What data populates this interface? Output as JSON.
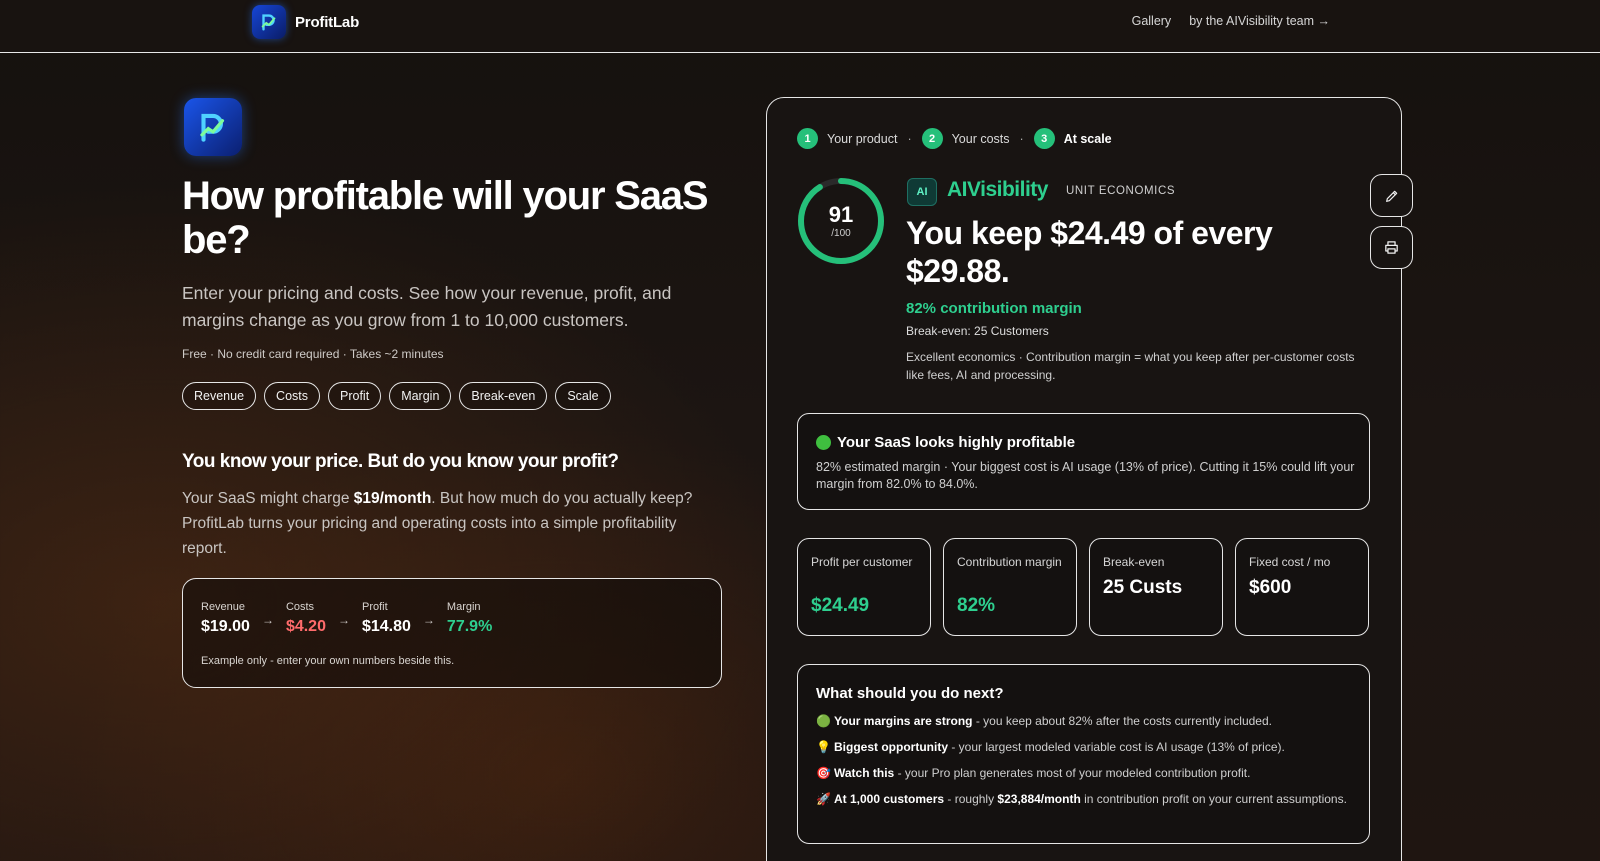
{
  "header": {
    "brand": "ProfitLab",
    "nav": [
      "Gallery",
      "by the AIVisibility team →"
    ]
  },
  "hero": {
    "title": "How profitable will your SaaS be?",
    "subtitle": "Enter your pricing and costs. See how your revenue, profit, and margins change as you grow from 1 to 10,000 customers.",
    "meta": "Free · No credit card required · Takes ~2 minutes",
    "chips": [
      "Revenue",
      "Costs",
      "Profit",
      "Margin",
      "Break-even",
      "Scale"
    ]
  },
  "question": {
    "title": "You know your price. But do you know your profit?",
    "body_pre": "Your SaaS might charge ",
    "body_bold": "$19/month",
    "body_post": ". But how much do you actually keep? ProfitLab turns your pricing and operating costs into a simple profitability report."
  },
  "example": {
    "items": [
      {
        "label": "Revenue",
        "value": "$19.00"
      },
      {
        "label": "Costs",
        "value": "$4.20"
      },
      {
        "label": "Profit",
        "value": "$14.80"
      },
      {
        "label": "Margin",
        "value": "77.9%"
      }
    ],
    "arrow": "→",
    "note": "Example only - enter your own numbers beside this."
  },
  "steps": [
    {
      "num": "1",
      "label": "Your product"
    },
    {
      "num": "2",
      "label": "Your costs"
    },
    {
      "num": "3",
      "label": "At scale"
    }
  ],
  "step_sep": "·",
  "score": {
    "value": "91",
    "denominator": "/100",
    "fraction": 0.91
  },
  "product": {
    "badge": "AI",
    "name": "AIVisibility",
    "tag": "UNIT ECONOMICS",
    "headline": "You keep $24.49 of every $29.88.",
    "contribution": "82% contribution margin",
    "breakeven": "Break-even: 25 Customers",
    "explain": "Excellent economics · Contribution margin = what you keep after per-customer costs like fees, AI and processing."
  },
  "actions": {
    "edit": "pencil-icon",
    "print": "printer-icon"
  },
  "summary": {
    "title": "Your SaaS looks highly profitable",
    "body": "82% estimated margin · Your biggest cost is AI usage (13% of price). Cutting it 15% could lift your margin from 82.0% to 84.0%."
  },
  "metrics": [
    {
      "label": "Profit per customer",
      "value": "$24.49"
    },
    {
      "label": "Contribution margin",
      "value": "82%"
    },
    {
      "label": "Break-even",
      "value": "25 Custs"
    },
    {
      "label": "Fixed cost / mo",
      "value": "$600"
    }
  ],
  "next": {
    "title": "What should you do next?",
    "items": [
      {
        "icon": "🟢",
        "bold": "Your margins are strong",
        "text": " - you keep about 82% after the costs currently included."
      },
      {
        "icon": "💡",
        "bold": "Biggest opportunity",
        "text": " - your largest modeled variable cost is AI usage (13% of price)."
      },
      {
        "icon": "🎯",
        "bold": "Watch this",
        "text": " - your Pro plan generates most of your modeled contribution profit."
      },
      {
        "icon": "🚀",
        "bold": "At 1,000 customers",
        "text": " - roughly ",
        "bold2": "$23,884/month",
        "text2": " in contribution profit on your current assumptions."
      }
    ]
  },
  "colors": {
    "accent": "#2ecf8f",
    "step": "#25c07a",
    "negative": "#ff6b6b",
    "brand": "#1646d6"
  }
}
